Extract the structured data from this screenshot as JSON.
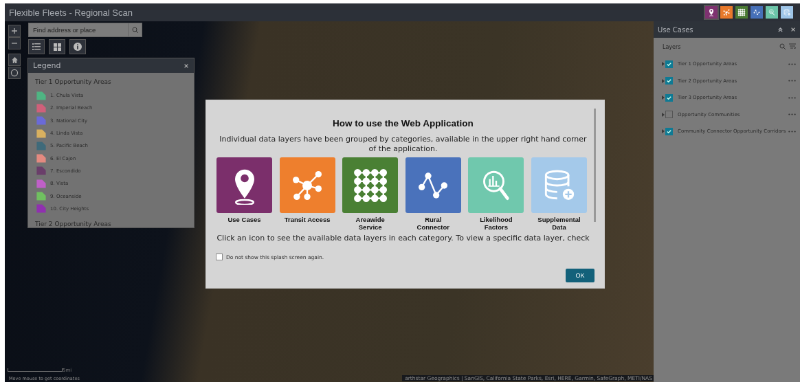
{
  "app_title": "Flexible Fleets - Regional Scan",
  "category_buttons": [
    {
      "kind": "pin",
      "color": "#7e3270",
      "selected": true
    },
    {
      "kind": "network",
      "color": "#e8792b",
      "selected": false
    },
    {
      "kind": "grid",
      "color": "#4a7a33",
      "selected": false
    },
    {
      "kind": "line",
      "color": "#4670b8",
      "selected": false
    },
    {
      "kind": "chart",
      "color": "#6cc5a9",
      "selected": false
    },
    {
      "kind": "database",
      "color": "#9ec5e8",
      "selected": false
    }
  ],
  "search": {
    "placeholder": "Find address or place"
  },
  "legend": {
    "title": "Legend",
    "groups": [
      {
        "title": "Tier 1 Opportunity Areas",
        "items": [
          {
            "label": "1. Chula Vista",
            "color": "#4fb583"
          },
          {
            "label": "2. Imperial Beach",
            "color": "#d0607a"
          },
          {
            "label": "3. National City",
            "color": "#6a6ad8"
          },
          {
            "label": "4. Linda Vista",
            "color": "#d8b060"
          },
          {
            "label": "5. Pacific Beach",
            "color": "#3f6a7a"
          },
          {
            "label": "6. El Cajon",
            "color": "#e48a80"
          },
          {
            "label": "7. Escondido",
            "color": "#6a3e6a"
          },
          {
            "label": "8. Vista",
            "color": "#c060c8"
          },
          {
            "label": "9. Oceanside",
            "color": "#70c060"
          },
          {
            "label": "10. City Heights",
            "color": "#9030b0"
          }
        ]
      },
      {
        "title": "Tier 2 Opportunity Areas"
      }
    ]
  },
  "layers_panel": {
    "title": "Use Cases",
    "heading": "Layers",
    "layers": [
      {
        "label": "Tier 1 Opportunity Areas",
        "checked": true
      },
      {
        "label": "Tier 2 Opportunity Areas",
        "checked": true
      },
      {
        "label": "Tier 3 Opportunity Areas",
        "checked": true
      },
      {
        "label": "Opportunity Communities",
        "checked": false
      },
      {
        "label": "Community Connector Opportunity Corridors",
        "checked": true
      }
    ]
  },
  "splash": {
    "title": "How to use the Web Application",
    "intro": "Individual data layers have been grouped by categories, available in the upper right hand corner of the application.",
    "categories": [
      {
        "label": "Use Cases",
        "kind": "pin",
        "color": "#7b2f6b"
      },
      {
        "label": "Transit Access",
        "kind": "network",
        "color": "#ee7f2d"
      },
      {
        "label": "Areawide Service",
        "kind": "grid",
        "color": "#4a8034"
      },
      {
        "label": "Rural Connector",
        "kind": "line",
        "color": "#4a72bb"
      },
      {
        "label": "Likelihood Factors",
        "kind": "chart",
        "color": "#70c8ad"
      },
      {
        "label": "Supplemental Data",
        "kind": "database",
        "color": "#a4c9ea"
      }
    ],
    "instruction": "Click an icon to see the available data layers in each category. To view a specific data layer, check",
    "checkbox": {
      "label": "Do not show this splash screen again.",
      "checked": false
    },
    "ok": "OK"
  },
  "map": {
    "scale": "5mi",
    "coordinates": "Move mouse to get coordinates",
    "attribution": "arthstar Geographics | SanGIS, California State Parks, Esri, HERE, Garmin, SafeGraph, METI/NAS"
  }
}
